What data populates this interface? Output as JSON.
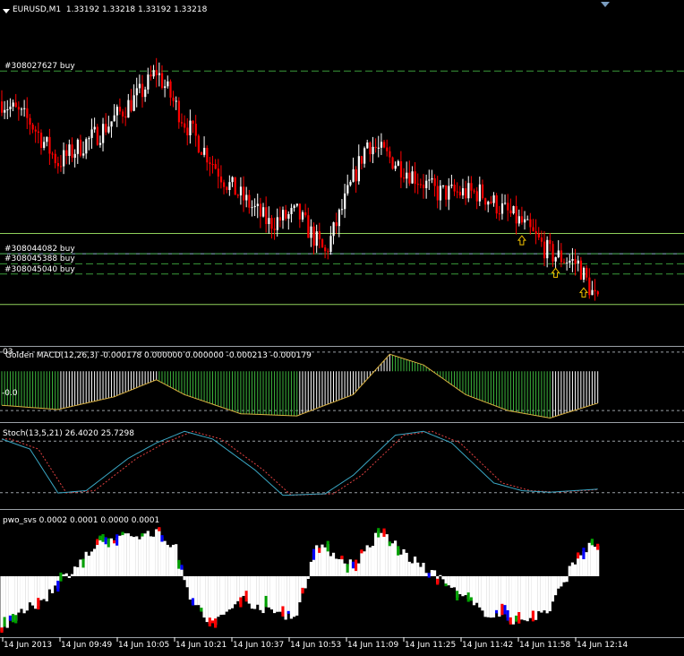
{
  "window": {
    "symbol_title": "EURUSD,M1",
    "ohlc": "1.33192 1.33218 1.33192 1.33218"
  },
  "colors": {
    "background": "#000000",
    "bull": "#ffffff",
    "bear": "#ff0000",
    "order_line": "#3a9a3a",
    "price_line": "#8fb9d0",
    "macd_hist_up": "#ffffff",
    "macd_hist_down": "#3cb43c",
    "stoch_main": "#3aa7c4",
    "stoch_signal": "#e04040",
    "separator": "#9aa0a6"
  },
  "panes": {
    "macd": {
      "title": "Golden MACD(12,26,3) -0.000178 0.000000 0.000000 -0.000213 -0.000179",
      "level_label": "-0.0",
      "corner_label": "03"
    },
    "stoch": {
      "title": "Stoch(13,5,21) 26.4020 25.7298"
    },
    "pwo": {
      "title": "pwo_svs 0.0002 0.0001 0.0000 0.0001"
    }
  },
  "chart_data": [
    {
      "type": "candlestick",
      "symbol": "EURUSD",
      "timeframe": "M1",
      "ohlc_last": [
        1.33192,
        1.33218,
        1.33192,
        1.33218
      ],
      "order_lines": [
        {
          "label": "#308027627 buy",
          "price": 1.3343
        },
        {
          "label": "#308044082 buy",
          "price": 1.3325
        },
        {
          "label": "#308045388 buy",
          "price": 1.3324
        },
        {
          "label": "#308045040 buy",
          "price": 1.3323
        }
      ],
      "horizontal_lines": [
        1.3327,
        1.3325,
        1.332
      ],
      "close_path_knots": [
        [
          0,
          1.334
        ],
        [
          10,
          1.3338
        ],
        [
          20,
          1.3334
        ],
        [
          35,
          1.3337
        ],
        [
          50,
          1.3341
        ],
        [
          55,
          1.3343
        ],
        [
          65,
          1.3338
        ],
        [
          80,
          1.3332
        ],
        [
          95,
          1.3328
        ],
        [
          105,
          1.3329
        ],
        [
          115,
          1.3325
        ],
        [
          130,
          1.3336
        ],
        [
          140,
          1.3334
        ],
        [
          155,
          1.3331
        ],
        [
          170,
          1.3331
        ],
        [
          185,
          1.3328
        ],
        [
          195,
          1.3325
        ],
        [
          205,
          1.3324
        ],
        [
          212,
          1.332
        ]
      ],
      "signal_arrows": [
        185,
        197,
        207
      ]
    },
    {
      "type": "bar",
      "name": "Golden MACD",
      "values_sketch_knots": [
        [
          0,
          -0.0002
        ],
        [
          20,
          -0.00024
        ],
        [
          40,
          -0.00012
        ],
        [
          55,
          4e-05
        ],
        [
          65,
          -0.0001
        ],
        [
          85,
          -0.00028
        ],
        [
          105,
          -0.0003
        ],
        [
          125,
          -0.0001
        ],
        [
          138,
          0.00028
        ],
        [
          150,
          0.00018
        ],
        [
          165,
          -0.0001
        ],
        [
          180,
          -0.00025
        ],
        [
          195,
          -0.00032
        ],
        [
          212,
          -0.00018
        ]
      ],
      "ylim": [
        -0.00035,
        0.00035
      ]
    },
    {
      "type": "line",
      "name": "Stoch",
      "params": [
        13,
        5,
        21
      ],
      "values": {
        "main": 26.402,
        "signal": 25.7298
      },
      "main_knots": [
        [
          0,
          85
        ],
        [
          10,
          72
        ],
        [
          20,
          15
        ],
        [
          30,
          18
        ],
        [
          45,
          60
        ],
        [
          55,
          80
        ],
        [
          65,
          95
        ],
        [
          75,
          85
        ],
        [
          90,
          45
        ],
        [
          100,
          12
        ],
        [
          115,
          14
        ],
        [
          125,
          38
        ],
        [
          140,
          90
        ],
        [
          150,
          95
        ],
        [
          160,
          80
        ],
        [
          175,
          28
        ],
        [
          185,
          18
        ],
        [
          195,
          16
        ],
        [
          212,
          20
        ]
      ],
      "ylim": [
        0,
        100
      ]
    },
    {
      "type": "bar",
      "name": "pwo_svs",
      "values": [
        0.0002,
        0.0001,
        0.0,
        0.0001
      ],
      "colors": [
        "#ffffff",
        "#0000ff",
        "#ff0000",
        "#00a000"
      ],
      "values_sketch_knots": [
        [
          0,
          -0.00022
        ],
        [
          15,
          -0.0001
        ],
        [
          25,
          3e-05
        ],
        [
          35,
          0.00015
        ],
        [
          45,
          0.00018
        ],
        [
          55,
          0.0002
        ],
        [
          62,
          0.00012
        ],
        [
          68,
          -0.00012
        ],
        [
          75,
          -0.00022
        ],
        [
          85,
          -0.0001
        ],
        [
          95,
          -0.00015
        ],
        [
          105,
          -0.00018
        ],
        [
          112,
          0.00015
        ],
        [
          125,
          5e-05
        ],
        [
          135,
          0.0002
        ],
        [
          145,
          8e-05
        ],
        [
          160,
          -5e-05
        ],
        [
          170,
          -0.00015
        ],
        [
          185,
          -0.0002
        ],
        [
          195,
          -0.00015
        ],
        [
          205,
          0.0001
        ],
        [
          212,
          0.00015
        ]
      ],
      "ylim": [
        -0.00025,
        0.00025
      ]
    }
  ],
  "time_axis": [
    "14 Jun 2013",
    "14 Jun 09:49",
    "14 Jun 10:05",
    "14 Jun 10:21",
    "14 Jun 10:37",
    "14 Jun 10:53",
    "14 Jun 11:09",
    "14 Jun 11:25",
    "14 Jun 11:42",
    "14 Jun 11:58",
    "14 Jun 12:14"
  ]
}
